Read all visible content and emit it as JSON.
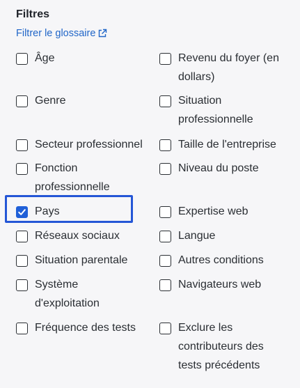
{
  "filters": {
    "title": "Filtres",
    "glossary_link": "Filtrer le glossaire",
    "glossary_icon": "external-link-icon",
    "accent_color": "#2060d8",
    "highlight_color": "#2456d6",
    "left_options": [
      {
        "label": "Âge",
        "checked": false
      },
      {
        "label": "Genre",
        "checked": false
      },
      {
        "label": "Secteur professionnel",
        "checked": false
      },
      {
        "label": "Fonction professionnelle",
        "checked": false
      },
      {
        "label": "Pays",
        "checked": true
      },
      {
        "label": "Réseaux sociaux",
        "checked": false
      },
      {
        "label": "Situation parentale",
        "checked": false
      },
      {
        "label": "Système d'exploitation",
        "checked": false
      },
      {
        "label": "Fréquence des tests",
        "checked": false
      }
    ],
    "right_options": [
      {
        "label": "Revenu du foyer (en dollars)",
        "checked": false
      },
      {
        "label": "Situation professionnelle",
        "checked": false
      },
      {
        "label": "Taille de l'entreprise",
        "checked": false
      },
      {
        "label": "Niveau du poste",
        "checked": false
      },
      {
        "label": "Expertise web",
        "checked": false
      },
      {
        "label": "Langue",
        "checked": false
      },
      {
        "label": "Autres conditions",
        "checked": false
      },
      {
        "label": "Navigateurs web",
        "checked": false
      },
      {
        "label": "Exclure les contributeurs des tests précédents",
        "checked": false
      }
    ]
  }
}
